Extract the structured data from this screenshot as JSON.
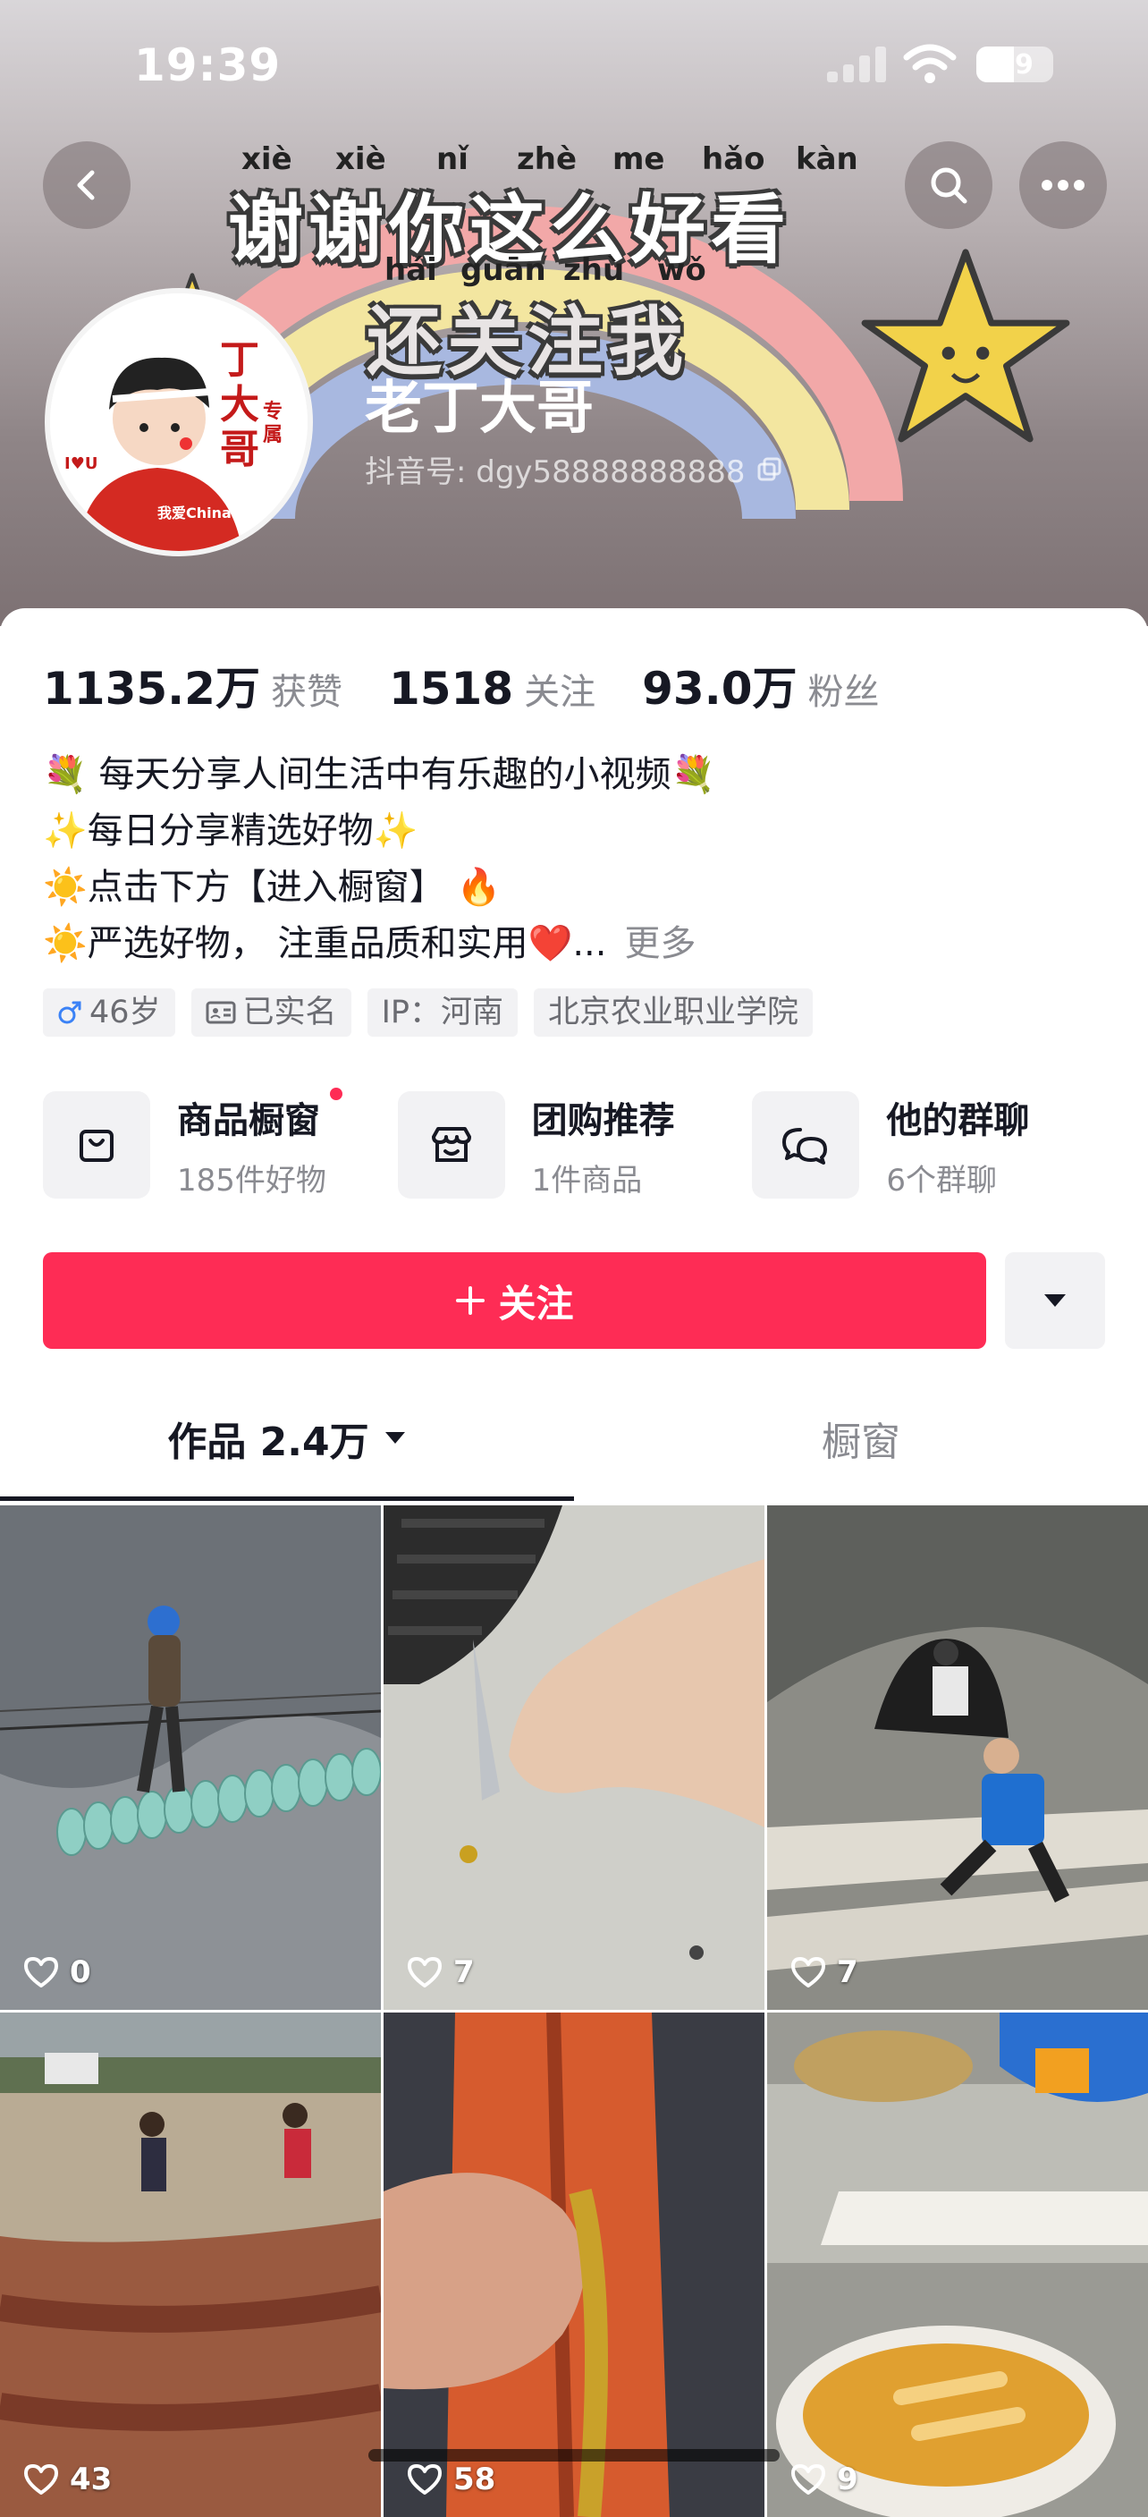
{
  "status_bar": {
    "time": "19:39",
    "battery_level": "49"
  },
  "banner": {
    "line1_pinyin": [
      "xiè",
      "xiè",
      "nǐ",
      "zhè",
      "me",
      "hǎo",
      "kàn"
    ],
    "line1_text": "谢谢你这么好看",
    "line2_pinyin": [
      "hái",
      "guān",
      "zhù",
      "wǒ"
    ],
    "line2_text": "还关注我"
  },
  "avatar": {
    "main_text": "丁大哥",
    "badge_text": "专属",
    "label_left": "I♥U",
    "label_bottom": "我爱China中国"
  },
  "profile": {
    "nickname": "老丁大哥",
    "douyin_id": "抖音号: dgy58888888888"
  },
  "stats": [
    {
      "value": "1135.2万",
      "label": "获赞"
    },
    {
      "value": "1518",
      "label": "关注"
    },
    {
      "value": "93.0万",
      "label": "粉丝"
    }
  ],
  "bio": {
    "lines": [
      "💐 每天分享人间生活中有乐趣的小视频💐",
      "✨每日分享精选好物✨",
      "☀️点击下方【进入橱窗】 🔥",
      "☀️严选好物， 注重品质和实用❤️..."
    ],
    "more_label": "更多"
  },
  "tags": [
    {
      "icon": "male-icon",
      "text": "46岁"
    },
    {
      "icon": "id-card-icon",
      "text": "已实名"
    },
    {
      "icon": "",
      "text": "IP：河南"
    },
    {
      "icon": "",
      "text": "北京农业职业学院"
    }
  ],
  "features": [
    {
      "icon": "shopping-bag-icon",
      "title": "商品橱窗",
      "sub": "185件好物",
      "has_dot": true
    },
    {
      "icon": "store-icon",
      "title": "团购推荐",
      "sub": "1件商品",
      "has_dot": false
    },
    {
      "icon": "chat-icon",
      "title": "他的群聊",
      "sub": "6个群聊",
      "has_dot": false
    }
  ],
  "follow_button": {
    "label": "关注"
  },
  "tabs": {
    "works_label": "作品 2.4万",
    "window_label": "橱窗"
  },
  "videos": [
    {
      "likes": "0"
    },
    {
      "likes": "7"
    },
    {
      "likes": "7"
    },
    {
      "likes": "43"
    },
    {
      "likes": "58"
    },
    {
      "likes": "9"
    }
  ],
  "colors": {
    "accent": "#fe2c55",
    "text_primary": "#161823",
    "text_secondary": "#8a8b91"
  }
}
